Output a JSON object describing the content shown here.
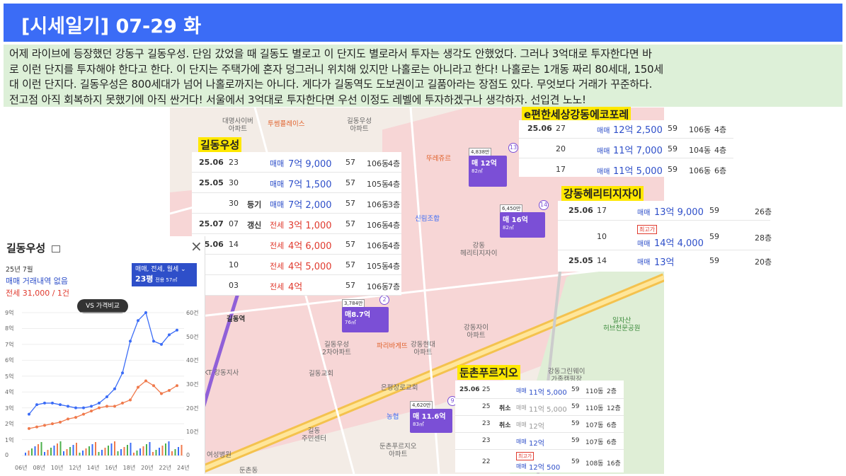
{
  "header": {
    "title": "[시세일기] 07-29 화"
  },
  "intro": {
    "lines": [
      "어제 라이브에 등장했던 강동구 길동우성. 단임 갔었을 때 길동도 별로고 이 단지도 별로라서 투자는 생각도 안했었다. 그러나 3억대로 투자한다면 바",
      "로 이런 단지를 투자해야 한다고 한다. 이 단지는 주택가에 혼자 덩그러니 위치해 있지만 나홀로는 아니라고 한다! 나홀로는 1개동 짜리 80세대, 150세",
      "대 이런 단지다. 길동우성은 800세대가 넘어 나홀로까지는 아니다. 게다가 길동역도 도보권이고 길품아라는 장점도 있다. 무엇보다 거래가 꾸준하다.",
      "전고점 아직 회복하지 못했기에 아직 싼거다! 서울에서 3억대로 투자한다면 우선 이정도 레벨에 투자하겠구나 생각하자. 선입견 노노!"
    ]
  },
  "map": {
    "labels": [
      {
        "t": "대명사이버\n아파트"
      },
      {
        "t": "투썸플레이스"
      },
      {
        "t": "길동우성\n아파트"
      },
      {
        "t": "뚜레쥬르"
      },
      {
        "t": "신림조합"
      },
      {
        "t": "강동\n헤리티지자이"
      },
      {
        "t": "강동자이\n아파트"
      },
      {
        "t": "길동우성\n2차아파트"
      },
      {
        "t": "강동현대\n아파트"
      },
      {
        "t": "파리바게뜨"
      },
      {
        "t": "KT 강동지사"
      },
      {
        "t": "길동교회"
      },
      {
        "t": "은평장로교회"
      },
      {
        "t": "농협"
      },
      {
        "t": "길동\n주민센터"
      },
      {
        "t": "둔촌푸르지오\n아파트"
      },
      {
        "t": "일자산\n허브천문공원"
      },
      {
        "t": "강동그린웨이\n가족캠핑장"
      },
      {
        "t": "여성병원"
      },
      {
        "t": "길동역"
      },
      {
        "t": "둔촌동"
      }
    ],
    "bubbles": [
      {
        "tag": "4,838만",
        "label": "매 12억",
        "area": "82㎡",
        "num": "13"
      },
      {
        "tag": "6,450만",
        "label": "매 16억",
        "area": "82㎡",
        "num": "14"
      },
      {
        "tag": "3,784만",
        "label": "매8.7억",
        "area": "76㎡",
        "num": "2"
      },
      {
        "tag": "4,620만",
        "label": "매 11.6억",
        "area": "83㎡",
        "num": "9"
      }
    ]
  },
  "boxes": {
    "gildong": {
      "title": "길동우성",
      "rows": [
        {
          "date": "25.06",
          "day": "23",
          "kind": "",
          "type": "매매",
          "price": "7억 9,000",
          "area": "57",
          "dong": "106동",
          "floor": "4층"
        },
        {
          "date": "25.05",
          "day": "30",
          "kind": "",
          "type": "매매",
          "price": "7억 1,500",
          "area": "57",
          "dong": "105동",
          "floor": "4층"
        },
        {
          "date": "",
          "day": "30",
          "kind": "등기",
          "type": "매매",
          "price": "7억 2,000",
          "area": "57",
          "dong": "106동",
          "floor": "3층"
        },
        {
          "date": "25.07",
          "day": "07",
          "kind": "갱신",
          "type": "전세",
          "price": "3억 1,000",
          "area": "57",
          "dong": "106동",
          "floor": "4층"
        },
        {
          "date": "25.06",
          "day": "14",
          "kind": "",
          "type": "전세",
          "price": "4억 6,000",
          "area": "57",
          "dong": "106동",
          "floor": "4층"
        },
        {
          "date": "",
          "day": "10",
          "kind": "",
          "type": "전세",
          "price": "4억 5,000",
          "area": "57",
          "dong": "105동",
          "floor": "4층"
        },
        {
          "date": "",
          "day": "03",
          "kind": "",
          "type": "전세",
          "price": "4억",
          "area": "57",
          "dong": "106동",
          "floor": "7층"
        }
      ]
    },
    "ecoforet": {
      "title": "e편한세상강동에코포레",
      "rows": [
        {
          "date": "25.06",
          "day": "27",
          "type": "매매",
          "price": "12억 2,500",
          "area": "59",
          "dong": "106동",
          "floor": "4층"
        },
        {
          "date": "",
          "day": "20",
          "type": "매매",
          "price": "11억 7,000",
          "area": "59",
          "dong": "104동",
          "floor": "4층"
        },
        {
          "date": "",
          "day": "17",
          "type": "매매",
          "price": "11억 5,000",
          "area": "59",
          "dong": "106동",
          "floor": "6층"
        }
      ]
    },
    "heritage": {
      "title": "강동헤리티지자이",
      "rows": [
        {
          "date": "25.06",
          "day": "17",
          "badge": "",
          "type": "매매",
          "price": "13억 9,000",
          "area": "59",
          "floor": "26층"
        },
        {
          "date": "",
          "day": "10",
          "badge": "최고가",
          "type": "매매",
          "price": "14억 4,000",
          "area": "59",
          "floor": "28층"
        },
        {
          "date": "25.05",
          "day": "14",
          "badge": "",
          "type": "매매",
          "price": "13억",
          "area": "59",
          "floor": "20층"
        }
      ]
    },
    "dunchon": {
      "title": "둔촌푸르지오",
      "rows": [
        {
          "date": "25.06",
          "day": "25",
          "kind": "",
          "badge": "",
          "type": "매매",
          "price": "11억 5,000",
          "area": "59",
          "dong": "110동",
          "floor": "2층"
        },
        {
          "date": "",
          "day": "25",
          "kind": "취소",
          "badge": "",
          "type": "매매",
          "price": "11억 5,000",
          "area": "59",
          "dong": "110동",
          "floor": "12층"
        },
        {
          "date": "",
          "day": "23",
          "kind": "취소",
          "badge": "",
          "type": "매매",
          "price": "12억",
          "area": "59",
          "dong": "107동",
          "floor": "6층"
        },
        {
          "date": "",
          "day": "23",
          "kind": "",
          "badge": "",
          "type": "매매",
          "price": "12억",
          "area": "59",
          "dong": "107동",
          "floor": "6층"
        },
        {
          "date": "",
          "day": "22",
          "kind": "",
          "badge": "최고가",
          "type": "매매",
          "price": "12억 500",
          "area": "59",
          "dong": "108동",
          "floor": "16층"
        }
      ]
    }
  },
  "panel": {
    "title": "길동우성",
    "month": "25년 7월",
    "buy_status": "매매 거래내역 없음",
    "jeon_status": "전세 31,000 / 1건",
    "select_line1": "매매, 전세, 월세",
    "select_size": "23평",
    "select_area": "전용 57㎡",
    "vs_label": "VS 가격비교",
    "close": "×"
  },
  "chart_data": {
    "type": "line",
    "x": [
      "06년",
      "08년",
      "10년",
      "12년",
      "14년",
      "16년",
      "18년",
      "20년",
      "22년",
      "24년"
    ],
    "y_left_ticks": [
      "9억",
      "8억",
      "7억",
      "6억",
      "5억",
      "4억",
      "3억",
      "2억",
      "1억",
      "0"
    ],
    "y_right_ticks": [
      "60건",
      "50건",
      "40건",
      "30건",
      "20건",
      "10건",
      "0"
    ],
    "series": [
      {
        "color": "#3b6cf6",
        "values": [
          2.6,
          3.2,
          3.3,
          3.3,
          3.2,
          3.1,
          3.0,
          3.0,
          3.1,
          3.3,
          3.7,
          4.2,
          5.2,
          7.2,
          8.5,
          9.0,
          7.2,
          7.0,
          7.6,
          7.9
        ]
      },
      {
        "color": "#f07a4c",
        "values": [
          1.7,
          1.8,
          1.9,
          2.0,
          2.1,
          2.3,
          2.4,
          2.6,
          2.8,
          3.0,
          3.1,
          3.1,
          3.3,
          3.5,
          4.3,
          4.7,
          4.4,
          3.9,
          4.1,
          4.4
        ]
      }
    ]
  },
  "colors": {
    "header": "#3b6cf6",
    "intro_bg": "#ddf0d8",
    "highlight": "#ffe800",
    "buy": "#2e4fc9",
    "jeon": "#e03a2e",
    "bubble": "#7b4fd6"
  }
}
